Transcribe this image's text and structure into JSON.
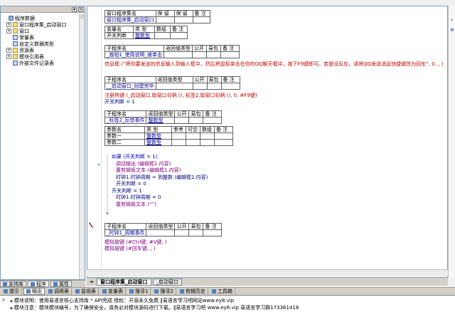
{
  "tree": {
    "items": [
      {
        "label": "程序数据",
        "level": 0,
        "expander": "",
        "icon": "database-icon"
      },
      {
        "label": "窗口程序集_启动窗口",
        "level": 1,
        "expander": "+",
        "icon": "module-icon"
      },
      {
        "label": "窗口",
        "level": 1,
        "expander": "+",
        "icon": "window-icon"
      },
      {
        "label": "常量表",
        "level": 1,
        "expander": "",
        "icon": "constant-icon"
      },
      {
        "label": "自定义数据类型",
        "level": 1,
        "expander": "",
        "icon": "datatype-icon"
      },
      {
        "label": "资源表",
        "level": 1,
        "expander": "+",
        "icon": "resource-icon"
      },
      {
        "label": "模块引用表",
        "level": 1,
        "expander": "+",
        "icon": "module-ref-icon"
      },
      {
        "label": "外部文件记录表",
        "level": 1,
        "expander": "",
        "icon": "file-icon"
      }
    ]
  },
  "left_tabs": [
    "支持库",
    "程序",
    "属性"
  ],
  "editor": {
    "assembly_table": {
      "headers": [
        "窗口程序集名",
        "保 留",
        "保 留",
        "备 注"
      ],
      "name": "窗口程序集_启动窗口",
      "var_headers": [
        "变量名",
        "类 型",
        "数组",
        "备 注"
      ],
      "var_name": "开关判断",
      "var_type": "整数型"
    },
    "sub1": {
      "headers": [
        "子程序名",
        "返回值类型",
        "公开",
        "易包",
        "备 注"
      ],
      "name": "_按钮1_使用说明_被单击",
      "code": "信息框 (“将你要发送的信息输入到输入框中，然后将鼠标单击在你的QQ聊天框中，按下F9键即可。若是没反应，请将QQ发送消息快捷键改为回车”, 0, , )"
    },
    "sub2": {
      "headers": [
        "子程序名",
        "返回值类型",
        "公开",
        "易包",
        "备 注"
      ],
      "name": "__启动窗口_创建完毕",
      "code1": "注册热键 (_启动窗口.取窗口句柄 (), 标签2.取窗口句柄 (), 0, #F9键)",
      "code2": "开关判断 = 1"
    },
    "sub3": {
      "headers": [
        "子程序名",
        "返回值类型",
        "公开",
        "易包",
        "备 注"
      ],
      "name": "_标签2_反馈事件",
      "ret_type": "整数型",
      "param_headers": [
        "参数名",
        "类 型",
        "参考",
        "可空",
        "数组",
        "备 注"
      ],
      "params": [
        {
          "name": "参数一",
          "type": "整数型"
        },
        {
          "name": "参数二",
          "type": "整数型"
        }
      ],
      "lines": [
        {
          "text": "如果 (开关判断 = 1)",
          "indent": 0,
          "color": "c-blue"
        },
        {
          "text": "调试输出 (编辑框1.内容)",
          "indent": 1,
          "color": "c-purple"
        },
        {
          "text": "置剪辑板文本 (编辑框1.内容)",
          "indent": 1,
          "color": "c-purple"
        },
        {
          "text": "时钟1.时钟周期 = 到整数 (编辑框1.内容)",
          "indent": 1,
          "color": "c-dblue"
        },
        {
          "text": "开关判断 = 0",
          "indent": 1,
          "color": "c-dblue"
        },
        {
          "text": "开关判断 = 1",
          "indent": 0,
          "color": "c-dblue"
        },
        {
          "text": "时钟1.时钟周期 = 0",
          "indent": 1,
          "color": "c-dblue"
        },
        {
          "text": "置剪辑板文本 (“”)",
          "indent": 1,
          "color": "c-purple"
        }
      ]
    },
    "sub4": {
      "headers": [
        "子程序名",
        "返回值类型",
        "公开",
        "易包",
        "备 注"
      ],
      "name": "_时钟1_周期事件",
      "code1": "模拟按键 (#Ctrl键, #V键, )",
      "code2": "模拟按键 (#回车键, , )"
    }
  },
  "editor_tabs": [
    "窗口程序集_启动窗口",
    "_启动窗口"
  ],
  "bottom_tabs": [
    "提示",
    "输出",
    "调用表",
    "监视表",
    "变量表",
    "搜寻1",
    "搜寻2",
    "剪辑历史",
    "工具箱"
  ],
  "output": {
    "lines": [
      "模块说明：使用易语言核心支持库 * API完成      授权：开源永久免费  ‖易语言学习吧网站www.ey8.vip",
      "模块注意：模块模块编号，为了确保安全，请务必对模块源码进行下载。‖易语言学习吧 www.ey8.vip 易语言学习群173361418"
    ]
  }
}
